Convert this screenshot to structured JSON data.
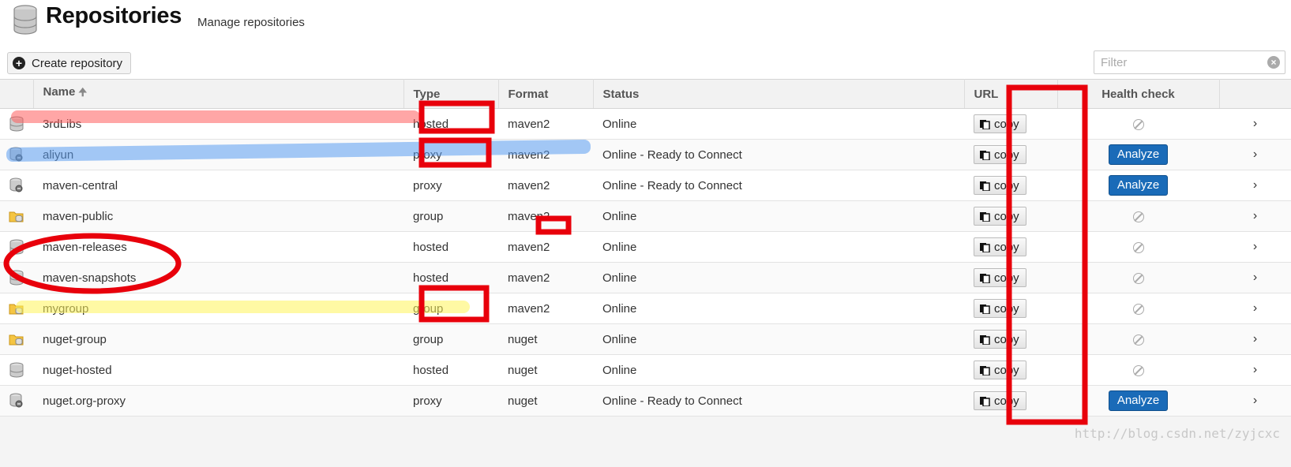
{
  "header": {
    "title": "Repositories",
    "subtitle": "Manage repositories",
    "create_label": "Create repository",
    "filter_placeholder": "Filter"
  },
  "columns": {
    "name": "Name",
    "type": "Type",
    "format": "Format",
    "status": "Status",
    "url": "URL",
    "health": "Health check"
  },
  "rows": [
    {
      "name": "3rdLibs",
      "type": "hosted",
      "format": "maven2",
      "status": "Online",
      "icon": "hosted-db-icon"
    },
    {
      "name": "aliyun",
      "type": "proxy",
      "format": "maven2",
      "status": "Online - Ready to Connect",
      "icon": "proxy-db-icon"
    },
    {
      "name": "maven-central",
      "type": "proxy",
      "format": "maven2",
      "status": "Online - Ready to Connect",
      "icon": "proxy-db-icon"
    },
    {
      "name": "maven-public",
      "type": "group",
      "format": "maven2",
      "status": "Online",
      "icon": "group-folder-icon"
    },
    {
      "name": "maven-releases",
      "type": "hosted",
      "format": "maven2",
      "status": "Online",
      "icon": "hosted-db-icon"
    },
    {
      "name": "maven-snapshots",
      "type": "hosted",
      "format": "maven2",
      "status": "Online",
      "icon": "hosted-db-icon"
    },
    {
      "name": "mygroup",
      "type": "group",
      "format": "maven2",
      "status": "Online",
      "icon": "group-folder-icon"
    },
    {
      "name": "nuget-group",
      "type": "group",
      "format": "nuget",
      "status": "Online",
      "icon": "group-folder-icon"
    },
    {
      "name": "nuget-hosted",
      "type": "hosted",
      "format": "nuget",
      "status": "Online",
      "icon": "hosted-db-icon"
    },
    {
      "name": "nuget.org-proxy",
      "type": "proxy",
      "format": "nuget",
      "status": "Online - Ready to Connect",
      "icon": "proxy-db-icon"
    }
  ],
  "copy_label": "copy",
  "analyze_label": "Analyze",
  "watermark": "http://blog.csdn.net/zyjcxc",
  "colors": {
    "annotation_red": "#e8000b",
    "analyze_blue": "#1a6bb8"
  }
}
